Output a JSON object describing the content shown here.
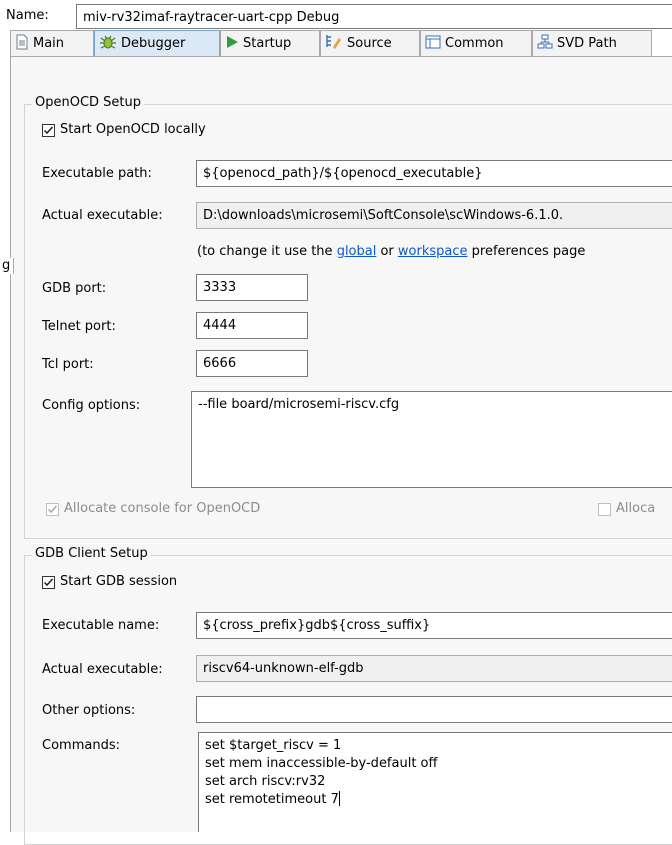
{
  "name": {
    "label": "Name:",
    "value": "miv-rv32imaf-raytracer-uart-cpp Debug"
  },
  "tabs": [
    {
      "label": "Main",
      "icon": "document-icon"
    },
    {
      "label": "Debugger",
      "icon": "bug-icon"
    },
    {
      "label": "Startup",
      "icon": "play-icon"
    },
    {
      "label": "Source",
      "icon": "source-lookup-icon"
    },
    {
      "label": "Common",
      "icon": "window-icon"
    },
    {
      "label": "SVD Path",
      "icon": "tree-icon"
    }
  ],
  "left_edge_char": "g",
  "openocd": {
    "group_title": "OpenOCD Setup",
    "start_locally": {
      "label": "Start OpenOCD locally",
      "checked": true
    },
    "exec_path_label": "Executable path:",
    "exec_path_value": "${openocd_path}/${openocd_executable}",
    "actual_exec_label": "Actual executable:",
    "actual_exec_value": "D:\\downloads\\microsemi\\SoftConsole\\scWindows-6.1.0.",
    "hint_prefix": "(to change it use the ",
    "hint_link_global": "global",
    "hint_or": " or ",
    "hint_link_workspace": "workspace",
    "hint_suffix": " preferences page",
    "gdb_port_label": "GDB port:",
    "gdb_port_value": "3333",
    "telnet_port_label": "Telnet port:",
    "telnet_port_value": "4444",
    "tcl_port_label": "Tcl port:",
    "tcl_port_value": "6666",
    "config_label": "Config options:",
    "config_value": "--file board/microsemi-riscv.cfg",
    "allocate_console": {
      "label": "Allocate console for OpenOCD",
      "checked": true,
      "enabled": false
    },
    "allocate_right": {
      "label": "Alloca",
      "checked": false,
      "enabled": false
    }
  },
  "gdb": {
    "group_title": "GDB Client Setup",
    "start_session": {
      "label": "Start GDB session",
      "checked": true
    },
    "exec_name_label": "Executable name:",
    "exec_name_value": "${cross_prefix}gdb${cross_suffix}",
    "actual_exec_label": "Actual executable:",
    "actual_exec_value": "riscv64-unknown-elf-gdb",
    "other_options_label": "Other options:",
    "other_options_value": "",
    "commands_label": "Commands:",
    "commands_lines": [
      "set $target_riscv = 1",
      "set mem inaccessible-by-default off",
      "set arch riscv:rv32",
      "set remotetimeout 7"
    ]
  },
  "colors": {
    "selected_tab": "#dbe8f5",
    "link": "#0b57d0",
    "panel": "#f7f7f7"
  }
}
